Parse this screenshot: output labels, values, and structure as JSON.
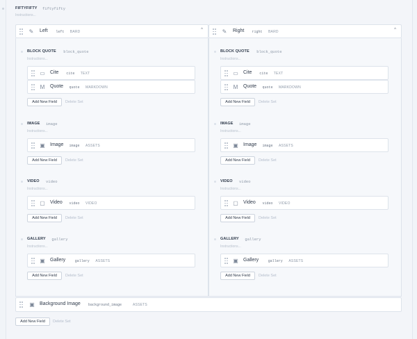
{
  "matrix": {
    "title": "FIFTYFIFTY",
    "handle": "fiftyfifty",
    "instructions": "Instructions..."
  },
  "columns": [
    {
      "name": "Left",
      "handle": "left",
      "type": "BARD",
      "chevron": "^",
      "sets": [
        {
          "title": "BLOCK QUOTE",
          "handle": "block_quote",
          "instructions": "Instructions...",
          "fields": [
            {
              "icon": "comment-icon",
              "glyph": "▭",
              "name": "Cite",
              "handle": "cite",
              "type": "TEXT"
            },
            {
              "icon": "markdown-icon",
              "glyph": "M",
              "name": "Quote",
              "handle": "quote",
              "type": "MARKDOWN"
            }
          ],
          "add": "Add New Field",
          "delete": "Delete Set"
        },
        {
          "title": "IMAGE",
          "handle": "image",
          "instructions": "Instructions...",
          "fields": [
            {
              "icon": "assets-icon",
              "glyph": "▣",
              "name": "Image",
              "handle": "image",
              "type": "ASSETS"
            }
          ],
          "add": "Add New Field",
          "delete": "Delete Set"
        },
        {
          "title": "VIDEO",
          "handle": "video",
          "instructions": "Instructions...",
          "fields": [
            {
              "icon": "video-icon",
              "glyph": "▢",
              "name": "Video",
              "handle": "video",
              "type": "VIDEO"
            }
          ],
          "add": "Add New Field",
          "delete": "Delete Set"
        },
        {
          "title": "GALLERY",
          "handle": "gallery",
          "instructions": "Instructions...",
          "fields": [
            {
              "icon": "assets-icon",
              "glyph": "▣",
              "name": "Gallery",
              "handle": "gallery",
              "type": "ASSETS"
            }
          ],
          "add": "Add New Field",
          "delete": "Delete Set"
        }
      ]
    },
    {
      "name": "Right",
      "handle": "right",
      "type": "BARD",
      "chevron": "^",
      "sets": [
        {
          "title": "BLOCK QUOTE",
          "handle": "block_quote",
          "instructions": "Instructions...",
          "fields": [
            {
              "icon": "comment-icon",
              "glyph": "▭",
              "name": "Cite",
              "handle": "cite",
              "type": "TEXT"
            },
            {
              "icon": "markdown-icon",
              "glyph": "M",
              "name": "Quote",
              "handle": "quote",
              "type": "MARKDOWN"
            }
          ],
          "add": "Add New Field",
          "delete": "Delete Set"
        },
        {
          "title": "IMAGE",
          "handle": "image",
          "instructions": "Instructions...",
          "fields": [
            {
              "icon": "assets-icon",
              "glyph": "▣",
              "name": "Image",
              "handle": "image",
              "type": "ASSETS"
            }
          ],
          "add": "Add New Field",
          "delete": "Delete Set"
        },
        {
          "title": "VIDEO",
          "handle": "video",
          "instructions": "Instructions...",
          "fields": [
            {
              "icon": "video-icon",
              "glyph": "▢",
              "name": "Video",
              "handle": "video",
              "type": "VIDEO"
            }
          ],
          "add": "Add New Field",
          "delete": "Delete Set"
        },
        {
          "title": "GALLERY",
          "handle": "gallery",
          "instructions": "Instructions...",
          "fields": [
            {
              "icon": "assets-icon",
              "glyph": "▣",
              "name": "Gallery",
              "handle": "gallery",
              "type": "ASSETS"
            }
          ],
          "add": "Add New Field",
          "delete": "Delete Set"
        }
      ]
    }
  ],
  "background_field": {
    "icon": "assets-icon",
    "glyph": "▣",
    "name": "Background Image",
    "handle": "background_image",
    "type": "ASSETS"
  },
  "footer": {
    "add": "Add New Field",
    "delete": "Delete Set"
  }
}
